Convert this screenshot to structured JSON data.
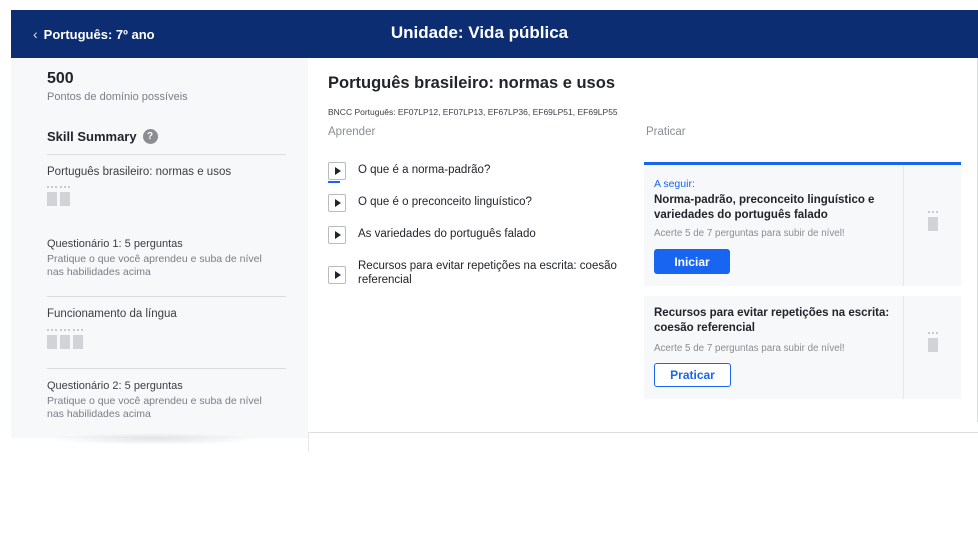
{
  "header": {
    "back_label": "Português: 7º ano",
    "unit_title": "Unidade: Vida pública"
  },
  "sidebar": {
    "points_value": "500",
    "points_label": "Pontos de domínio possíveis",
    "skill_summary_label": "Skill Summary",
    "help_icon": "question-circle-icon",
    "sections": [
      {
        "title": "Português brasileiro: normas e usos",
        "mastery_icon_count": 2
      },
      {
        "title": "Questionário 1: 5 perguntas",
        "description": "Pratique o que você aprendeu e suba de nível nas habilidades acima"
      },
      {
        "title": "Funcionamento da língua",
        "mastery_icon_count": 3
      },
      {
        "title": "Questionário 2: 5 perguntas",
        "description": "Pratique o que você aprendeu e suba de nível nas habilidades acima"
      }
    ]
  },
  "lesson": {
    "title": "Português brasileiro: normas e usos",
    "bncc": "BNCC Português: EF07LP12, EF07LP13, EF67LP36, EF69LP51, EF69LP55",
    "learn_header": "Aprender",
    "practice_header": "Praticar",
    "learn_items": [
      {
        "label": "O que é a norma-padrão?",
        "icon": "play-icon"
      },
      {
        "label": "O que é o preconceito linguístico?",
        "icon": "play-icon"
      },
      {
        "label": "As variedades do português falado",
        "icon": "play-icon"
      },
      {
        "label": "Recursos para evitar repetições na escrita: coesão referencial",
        "icon": "play-icon"
      }
    ],
    "practice_cards": [
      {
        "tag": "A seguir:",
        "title": "Norma-padrão, preconceito linguístico e variedades do português falado",
        "description": "Acerte 5 de 7 perguntas para subir de nível!",
        "button_label": "Iniciar"
      },
      {
        "title": "Recursos para evitar repetições na escrita: coesão referencial",
        "description": "Acerte 5 de 7 perguntas para subir de nível!",
        "button_label": "Praticar"
      }
    ]
  },
  "colors": {
    "header_bg": "#0c2d72",
    "accent": "#1865f2",
    "sidebar_bg": "#f7f8fa"
  }
}
